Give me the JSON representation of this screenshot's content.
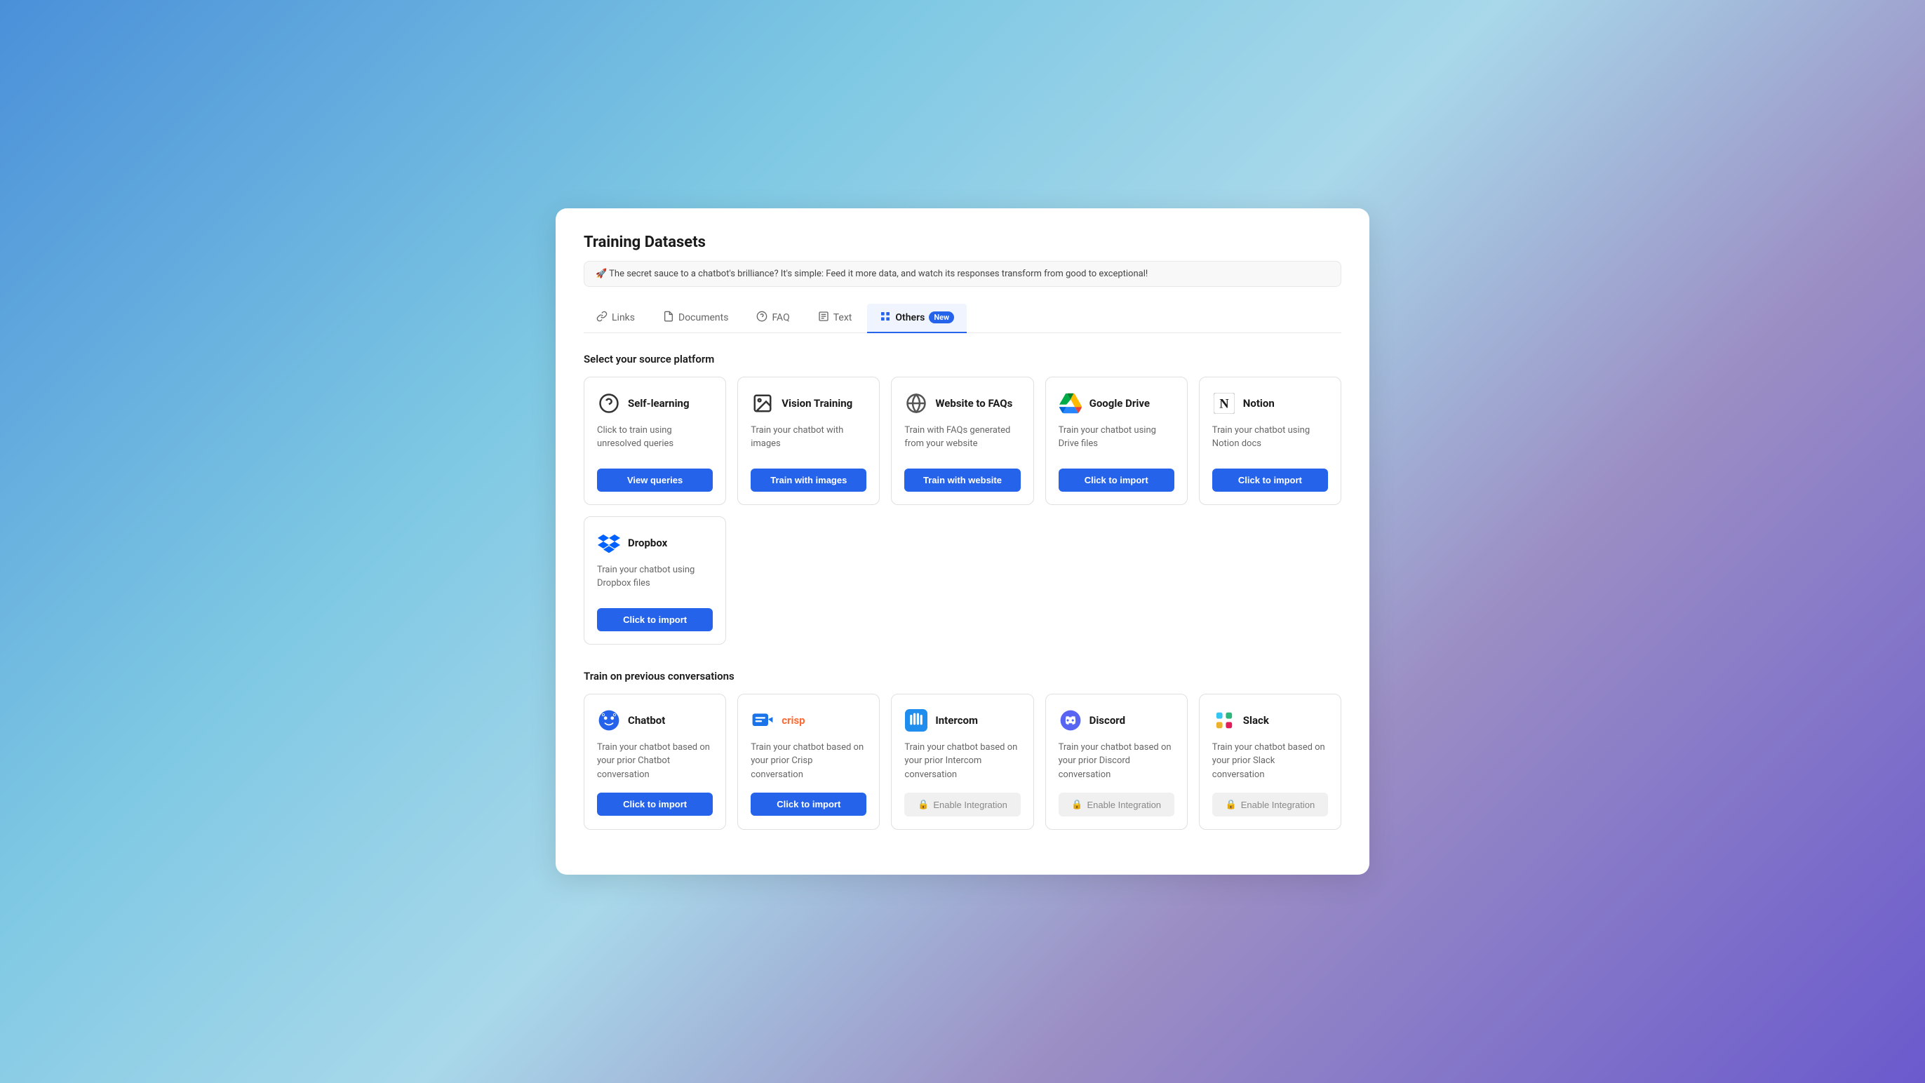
{
  "page": {
    "title": "Training Datasets",
    "info_banner": "🚀 The secret sauce to a chatbot's brilliance? It's simple: Feed it more data, and watch its responses transform from good to exceptional!"
  },
  "tabs": [
    {
      "id": "links",
      "label": "Links",
      "active": false
    },
    {
      "id": "documents",
      "label": "Documents",
      "active": false
    },
    {
      "id": "faq",
      "label": "FAQ",
      "active": false
    },
    {
      "id": "text",
      "label": "Text",
      "active": false
    },
    {
      "id": "others",
      "label": "Others",
      "active": true,
      "badge": "New"
    }
  ],
  "source_platform": {
    "section_title": "Select your source platform",
    "cards": [
      {
        "id": "self-learning",
        "title": "Self-learning",
        "desc": "Click to train using unresolved queries",
        "btn_label": "View queries",
        "btn_type": "primary"
      },
      {
        "id": "vision-training",
        "title": "Vision Training",
        "desc": "Train your chatbot with images",
        "btn_label": "Train with images",
        "btn_type": "primary"
      },
      {
        "id": "website-to-faqs",
        "title": "Website to FAQs",
        "desc": "Train with FAQs generated from your website",
        "btn_label": "Train with website",
        "btn_type": "primary"
      },
      {
        "id": "google-drive",
        "title": "Google Drive",
        "desc": "Train your chatbot using Drive files",
        "btn_label": "Click to import",
        "btn_type": "primary"
      },
      {
        "id": "notion",
        "title": "Notion",
        "desc": "Train your chatbot using Notion docs",
        "btn_label": "Click to import",
        "btn_type": "primary"
      }
    ],
    "cards_row2": [
      {
        "id": "dropbox",
        "title": "Dropbox",
        "desc": "Train your chatbot using Dropbox files",
        "btn_label": "Click to import",
        "btn_type": "primary"
      }
    ]
  },
  "conversations": {
    "section_title": "Train on previous conversations",
    "cards": [
      {
        "id": "chatbot",
        "title": "Chatbot",
        "desc": "Train your chatbot based on your prior Chatbot conversation",
        "btn_label": "Click to import",
        "btn_type": "primary"
      },
      {
        "id": "crisp",
        "title": "crisp",
        "desc": "Train your chatbot based on your prior Crisp conversation",
        "btn_label": "Click to import",
        "btn_type": "primary"
      },
      {
        "id": "intercom",
        "title": "Intercom",
        "desc": "Train your chatbot based on your prior Intercom conversation",
        "btn_label": "Enable Integration",
        "btn_type": "locked"
      },
      {
        "id": "discord",
        "title": "Discord",
        "desc": "Train your chatbot based on your prior Discord conversation",
        "btn_label": "Enable Integration",
        "btn_type": "locked"
      },
      {
        "id": "slack",
        "title": "Slack",
        "desc": "Train your chatbot based on your prior Slack conversation",
        "btn_label": "Enable Integration",
        "btn_type": "locked"
      }
    ]
  }
}
